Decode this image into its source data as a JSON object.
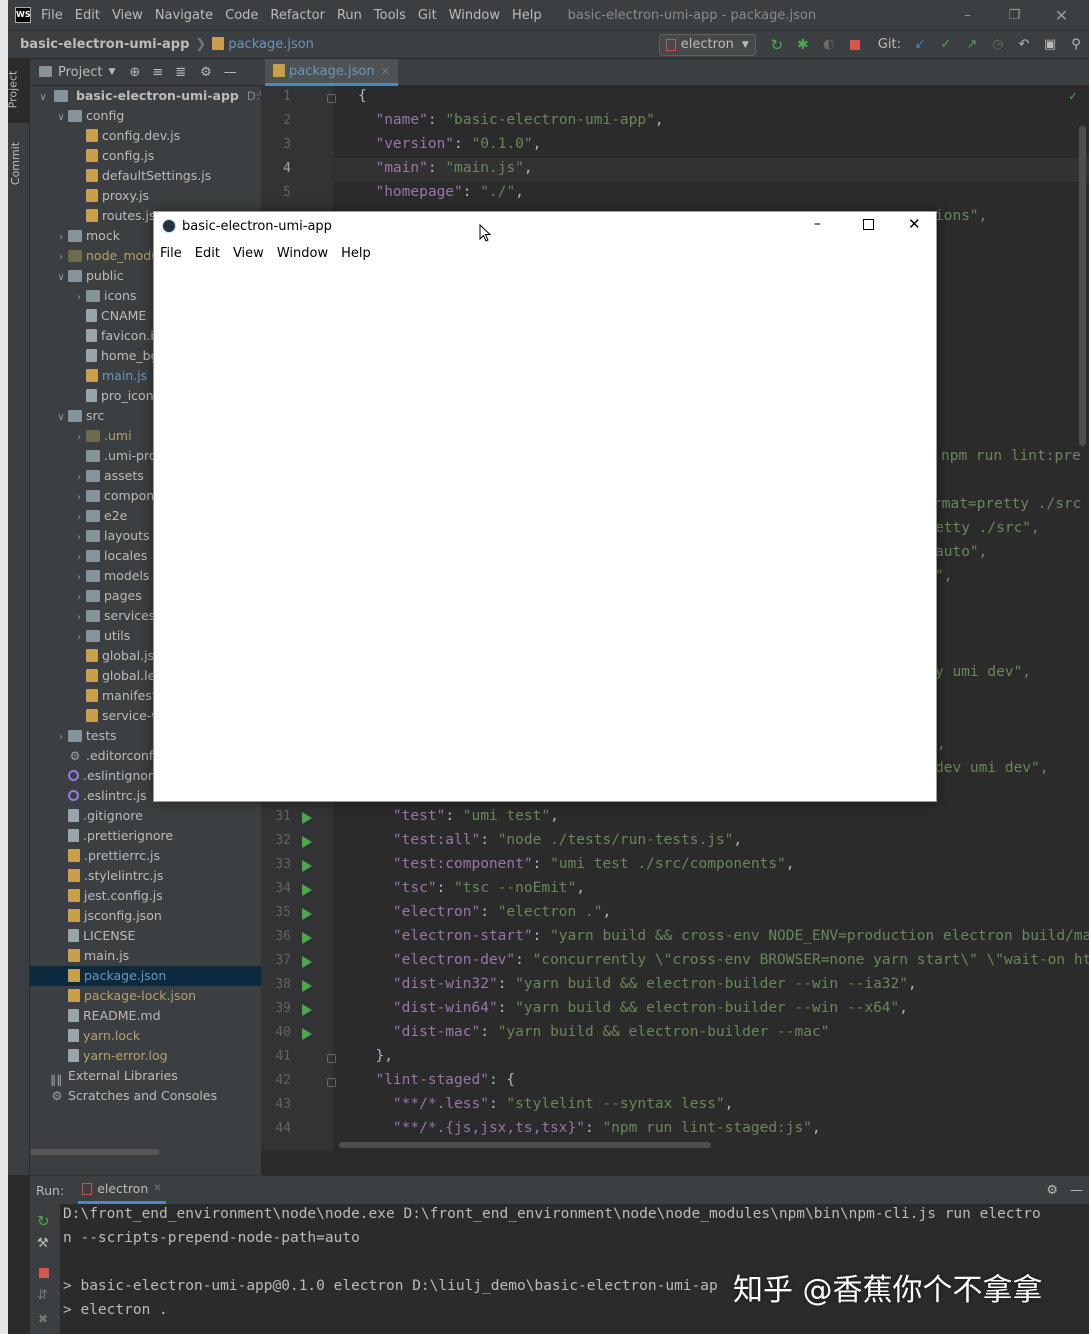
{
  "titlebar": {
    "menus": [
      "File",
      "Edit",
      "View",
      "Navigate",
      "Code",
      "Refactor",
      "Run",
      "Tools",
      "Git",
      "Window",
      "Help"
    ],
    "title": "basic-electron-umi-app - package.json"
  },
  "navbar": {
    "project": "basic-electron-umi-app",
    "file": "package.json",
    "run_config": "electron",
    "git_label": "Git:"
  },
  "sidestrip": {
    "project": "Project",
    "commit": "Commit"
  },
  "project_panel": {
    "header": "Project",
    "root_name": "basic-electron-umi-app",
    "root_path": "D:\\liulj_",
    "tree": [
      {
        "label": "config",
        "depth": 1,
        "kind": "folder",
        "open": true
      },
      {
        "label": "config.dev.js",
        "depth": 2,
        "kind": "js"
      },
      {
        "label": "config.js",
        "depth": 2,
        "kind": "js"
      },
      {
        "label": "defaultSettings.js",
        "depth": 2,
        "kind": "js"
      },
      {
        "label": "proxy.js",
        "depth": 2,
        "kind": "js"
      },
      {
        "label": "routes.js",
        "depth": 2,
        "kind": "js"
      },
      {
        "label": "mock",
        "depth": 1,
        "kind": "folder",
        "open": false
      },
      {
        "label": "node_modules",
        "depth": 1,
        "kind": "folder-dim",
        "open": false,
        "color": "olive"
      },
      {
        "label": "public",
        "depth": 1,
        "kind": "folder",
        "open": true
      },
      {
        "label": "icons",
        "depth": 2,
        "kind": "folder",
        "open": false
      },
      {
        "label": "CNAME",
        "depth": 2,
        "kind": "file"
      },
      {
        "label": "favicon.ico",
        "depth": 2,
        "kind": "file"
      },
      {
        "label": "home_bg.png",
        "depth": 2,
        "kind": "file"
      },
      {
        "label": "main.js",
        "depth": 2,
        "kind": "js",
        "color": "blue"
      },
      {
        "label": "pro_icon.svg",
        "depth": 2,
        "kind": "file"
      },
      {
        "label": "src",
        "depth": 1,
        "kind": "folder",
        "open": true
      },
      {
        "label": ".umi",
        "depth": 2,
        "kind": "folder-dim",
        "open": false,
        "color": "olive"
      },
      {
        "label": ".umi-production",
        "depth": 2,
        "kind": "folder"
      },
      {
        "label": "assets",
        "depth": 2,
        "kind": "folder",
        "open": false
      },
      {
        "label": "components",
        "depth": 2,
        "kind": "folder",
        "open": false
      },
      {
        "label": "e2e",
        "depth": 2,
        "kind": "folder",
        "open": false
      },
      {
        "label": "layouts",
        "depth": 2,
        "kind": "folder",
        "open": false
      },
      {
        "label": "locales",
        "depth": 2,
        "kind": "folder",
        "open": false
      },
      {
        "label": "models",
        "depth": 2,
        "kind": "folder",
        "open": false
      },
      {
        "label": "pages",
        "depth": 2,
        "kind": "folder",
        "open": false
      },
      {
        "label": "services",
        "depth": 2,
        "kind": "folder",
        "open": false
      },
      {
        "label": "utils",
        "depth": 2,
        "kind": "folder",
        "open": false
      },
      {
        "label": "global.jsx",
        "depth": 2,
        "kind": "js"
      },
      {
        "label": "global.less",
        "depth": 2,
        "kind": "js"
      },
      {
        "label": "manifest.json",
        "depth": 2,
        "kind": "json"
      },
      {
        "label": "service-worker.js",
        "depth": 2,
        "kind": "js"
      },
      {
        "label": "tests",
        "depth": 1,
        "kind": "folder",
        "open": false
      },
      {
        "label": ".editorconfig",
        "depth": 1,
        "kind": "gear"
      },
      {
        "label": ".eslintignore",
        "depth": 1,
        "kind": "circle"
      },
      {
        "label": ".eslintrc.js",
        "depth": 1,
        "kind": "circle"
      },
      {
        "label": ".gitignore",
        "depth": 1,
        "kind": "file"
      },
      {
        "label": ".prettierignore",
        "depth": 1,
        "kind": "file"
      },
      {
        "label": ".prettierrc.js",
        "depth": 1,
        "kind": "js"
      },
      {
        "label": ".stylelintrc.js",
        "depth": 1,
        "kind": "js"
      },
      {
        "label": "jest.config.js",
        "depth": 1,
        "kind": "js"
      },
      {
        "label": "jsconfig.json",
        "depth": 1,
        "kind": "json"
      },
      {
        "label": "LICENSE",
        "depth": 1,
        "kind": "file"
      },
      {
        "label": "main.js",
        "depth": 1,
        "kind": "js"
      },
      {
        "label": "package.json",
        "depth": 1,
        "kind": "json",
        "selected": true,
        "color": "blue"
      },
      {
        "label": "package-lock.json",
        "depth": 1,
        "kind": "json",
        "color": "olive"
      },
      {
        "label": "README.md",
        "depth": 1,
        "kind": "file"
      },
      {
        "label": "yarn.lock",
        "depth": 1,
        "kind": "file",
        "color": "olive"
      },
      {
        "label": "yarn-error.log",
        "depth": 1,
        "kind": "file",
        "color": "olive"
      }
    ],
    "external_libraries": "External Libraries",
    "scratches": "Scratches and Consoles"
  },
  "editor": {
    "tab": "package.json",
    "top_lines": [
      {
        "n": "1",
        "code": "{"
      },
      {
        "n": "2",
        "key": "\"name\"",
        "val": "\"basic-electron-umi-app\""
      },
      {
        "n": "3",
        "key": "\"version\"",
        "val": "\"0.1.0\""
      },
      {
        "n": "4",
        "key": "\"main\"",
        "val": "\"main.js\""
      },
      {
        "n": "5",
        "key": "\"homepage\"",
        "val": "\"./\""
      }
    ],
    "peek_fragments": [
      {
        "text": "ions\","
      },
      {
        "text": "npm run lint:pre"
      },
      {
        "text": "rmat=pretty ./src"
      },
      {
        "text": "etty ./src\","
      },
      {
        "text": "auto\","
      },
      {
        "text": "\","
      },
      {
        "text": "y umi dev\","
      },
      {
        "text": ","
      },
      {
        "text": "dev umi dev\","
      }
    ],
    "bottom_lines": [
      {
        "n": "31",
        "key": "\"test\"",
        "val": "\"umi test\"",
        "run": true
      },
      {
        "n": "32",
        "key": "\"test:all\"",
        "val": "\"node ./tests/run-tests.js\"",
        "run": true
      },
      {
        "n": "33",
        "key": "\"test:component\"",
        "val": "\"umi test ./src/components\"",
        "run": true
      },
      {
        "n": "34",
        "key": "\"tsc\"",
        "val": "\"tsc --noEmit\"",
        "run": true
      },
      {
        "n": "35",
        "key": "\"electron\"",
        "val": "\"electron .\"",
        "run": true
      },
      {
        "n": "36",
        "key": "\"electron-start\"",
        "val": "\"yarn build && cross-env NODE_ENV=production electron build/ma",
        "run": true
      },
      {
        "n": "37",
        "key": "\"electron-dev\"",
        "val": "\"concurrently \\\"cross-env BROWSER=none yarn start\\\" \\\"wait-on ht",
        "run": true
      },
      {
        "n": "38",
        "key": "\"dist-win32\"",
        "val": "\"yarn build && electron-builder --win --ia32\"",
        "run": true
      },
      {
        "n": "39",
        "key": "\"dist-win64\"",
        "val": "\"yarn build && electron-builder --win --x64\"",
        "run": true
      },
      {
        "n": "40",
        "key": "\"dist-mac\"",
        "val": "\"yarn build && electron-builder --mac\"",
        "run": true,
        "last": true
      },
      {
        "n": "41",
        "code": "  },"
      },
      {
        "n": "42",
        "key0": "\"lint-staged\"",
        "code_tail": ": {"
      },
      {
        "n": "43",
        "key": "\"**/*.less\"",
        "val": "\"stylelint --syntax less\""
      },
      {
        "n": "44",
        "key": "\"**/*.{js,jsx,ts,tsx}\"",
        "val": "\"npm run lint-staged:js\""
      }
    ]
  },
  "run_panel": {
    "label": "Run:",
    "tab": "electron",
    "lines": [
      "D:\\front_end_environment\\node\\node.exe D:\\front_end_environment\\node\\node_modules\\npm\\bin\\npm-cli.js run electro",
      "n --scripts-prepend-node-path=auto",
      "",
      "> basic-electron-umi-app@0.1.0 electron D:\\liulj_demo\\basic-electron-umi-ap",
      "> electron ."
    ]
  },
  "electron_window": {
    "title": "basic-electron-umi-app",
    "menus": [
      "File",
      "Edit",
      "View",
      "Window",
      "Help"
    ]
  },
  "watermark": "知乎 @香蕉你个不拿拿"
}
